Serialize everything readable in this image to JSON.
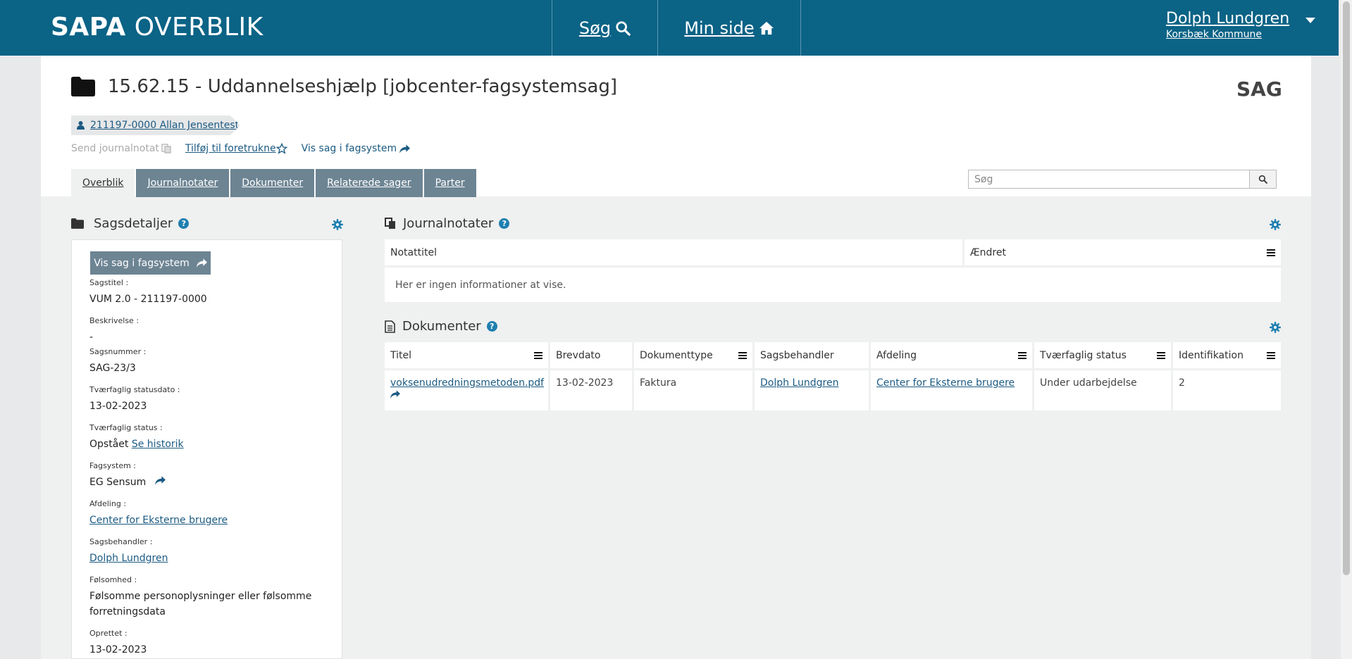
{
  "header": {
    "logo_bold": "SAPA",
    "logo_light": "OVERBLIK",
    "nav_search": "Søg",
    "nav_min_side": "Min side",
    "user_name": "Dolph Lundgren",
    "user_org": "Korsbæk Kommune"
  },
  "case": {
    "title": "15.62.15 - Uddannelseshjælp [jobcenter-fagsystemsag]",
    "type_label": "SAG",
    "person_link": "211197-0000 Allan Jensentest"
  },
  "actions": {
    "send_journalnotat": "Send journalnotat",
    "add_favorite": "Tilføj til foretrukne",
    "open_fagsystem": "Vis sag i fagsystem"
  },
  "tabs": [
    "Overblik",
    "Journalnotater",
    "Dokumenter",
    "Relaterede sager",
    "Parter"
  ],
  "search": {
    "placeholder": "Søg"
  },
  "sagsdetaljer": {
    "heading": "Sagsdetaljer",
    "button": "Vis sag i fagsystem",
    "fields": [
      {
        "label": "Sagstitel :",
        "value": "VUM 2.0 - 211197-0000"
      },
      {
        "label": "Beskrivelse :",
        "value": "-"
      },
      {
        "label": "Sagsnummer :",
        "value": "SAG-23/3"
      },
      {
        "label": "Tværfaglig statusdato :",
        "value": "13-02-2023"
      },
      {
        "label": "Tværfaglig status :",
        "value": "Opstået",
        "link": "Se historik"
      },
      {
        "label": "Fagsystem :",
        "value": "EG Sensum"
      },
      {
        "label": "Afdeling :",
        "link": "Center for Eksterne brugere"
      },
      {
        "label": "Sagsbehandler :",
        "link": "Dolph Lundgren"
      },
      {
        "label": "Følsomhed :",
        "value": "Følsomme personoplysninger eller følsomme forretningsdata"
      },
      {
        "label": "Oprettet :",
        "value": "13-02-2023"
      }
    ]
  },
  "journalnotater": {
    "heading": "Journalnotater",
    "columns": [
      "Notattitel",
      "Ændret"
    ],
    "empty": "Her er ingen informationer at vise."
  },
  "dokumenter": {
    "heading": "Dokumenter",
    "columns": [
      "Titel",
      "Brevdato",
      "Dokumenttype",
      "Sagsbehandler",
      "Afdeling",
      "Tværfaglig status",
      "Identifikation"
    ],
    "rows": [
      {
        "titel": "voksenudredningsmetoden.pdf",
        "brevdato": "13-02-2023",
        "dokumenttype": "Faktura",
        "sagsbehandler": "Dolph Lundgren",
        "afdeling": "Center for Eksterne brugere",
        "status": "Under udarbejdelse",
        "identifikation": "2"
      }
    ]
  },
  "colors": {
    "header_bg": "#0b6386",
    "tab_bg": "#6d8493",
    "link": "#1b5a82",
    "help": "#1f7fb0"
  }
}
